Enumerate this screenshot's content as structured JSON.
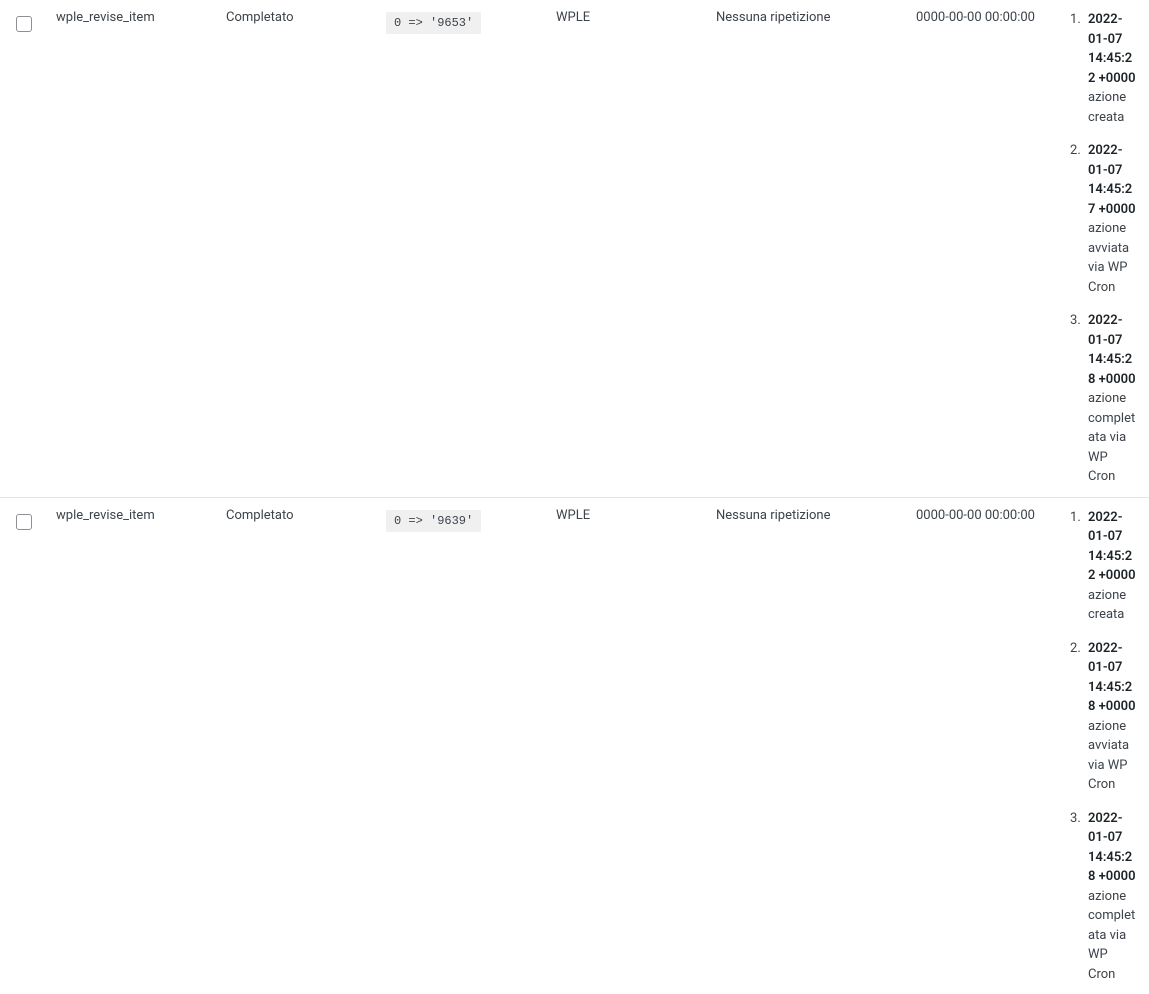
{
  "rows": [
    {
      "hook": "wple_revise_item",
      "status": "Completato",
      "args": "0 => '9653'",
      "group": "WPLE",
      "recurrence": "Nessuna ripetizione",
      "scheduled": "0000-00-00 00:00:00",
      "log": [
        {
          "ts": "2022-01-07 14:45:22 +0000",
          "msg": "azione creata"
        },
        {
          "ts": "2022-01-07 14:45:27 +0000",
          "msg": "azione avviata via WP Cron"
        },
        {
          "ts": "2022-01-07 14:45:28 +0000",
          "msg": "azione completata via WP Cron"
        }
      ]
    },
    {
      "hook": "wple_revise_item",
      "status": "Completato",
      "args": "0 => '9639'",
      "group": "WPLE",
      "recurrence": "Nessuna ripetizione",
      "scheduled": "0000-00-00 00:00:00",
      "log": [
        {
          "ts": "2022-01-07 14:45:22 +0000",
          "msg": "azione creata"
        },
        {
          "ts": "2022-01-07 14:45:28 +0000",
          "msg": "azione avviata via WP Cron"
        },
        {
          "ts": "2022-01-07 14:45:28 +0000",
          "msg": "azione completata via WP Cron"
        }
      ]
    }
  ]
}
